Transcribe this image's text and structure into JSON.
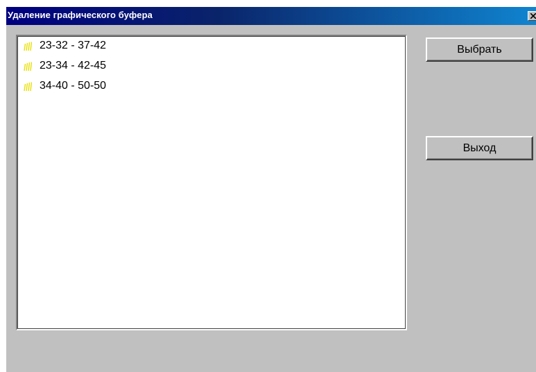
{
  "window": {
    "title": "Удаление графического буфера"
  },
  "list": {
    "items": [
      {
        "label": "23-32 - 37-42",
        "icon": "folder-stripes-icon"
      },
      {
        "label": "23-34 - 42-45",
        "icon": "folder-stripes-icon"
      },
      {
        "label": "34-40 - 50-50",
        "icon": "folder-stripes-icon"
      }
    ]
  },
  "buttons": {
    "select_label": "Выбрать",
    "exit_label": "Выход"
  },
  "colors": {
    "titlebar_start": "#000080",
    "titlebar_end": "#1084d0",
    "dialog_face": "#c0c0c0",
    "icon_yellow": "#e8e000"
  }
}
